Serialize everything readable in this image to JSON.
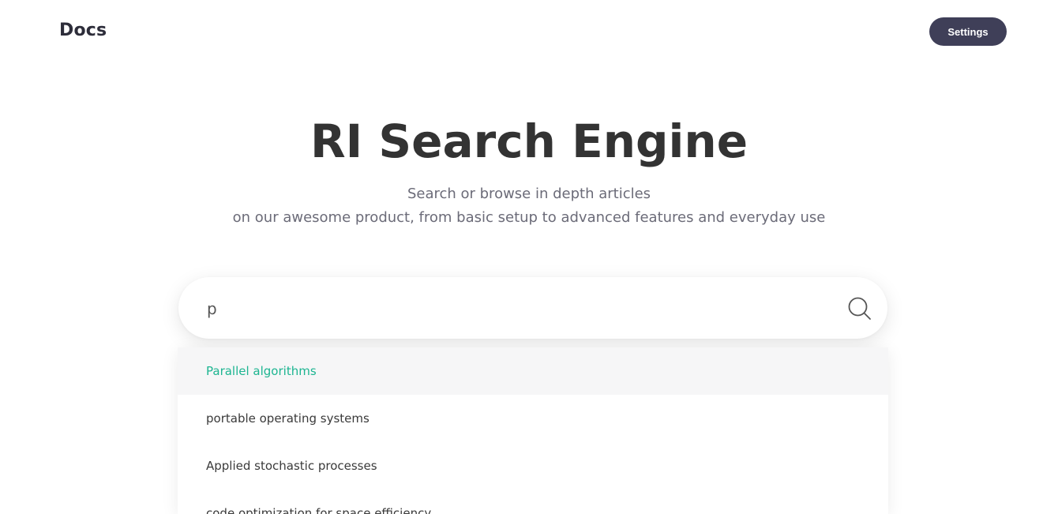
{
  "header": {
    "logo": "Docs",
    "settings_label": "Settings"
  },
  "hero": {
    "title": "RI Search Engine",
    "subtitle_line1": "Search or browse in depth articles",
    "subtitle_line2": "on our awesome product, from basic setup to advanced features and everyday use"
  },
  "search": {
    "value": "p",
    "icon": "search-icon"
  },
  "suggestions": {
    "items": [
      {
        "label": "Parallel algorithms",
        "active": true
      },
      {
        "label": "portable operating systems",
        "active": false
      },
      {
        "label": "Applied stochastic processes",
        "active": false
      },
      {
        "label": "code optimization for space efficiency",
        "active": false
      }
    ]
  },
  "colors": {
    "accent": "#1db591",
    "button_bg": "#3f3f58",
    "active_row_bg": "#f6f6f7"
  }
}
